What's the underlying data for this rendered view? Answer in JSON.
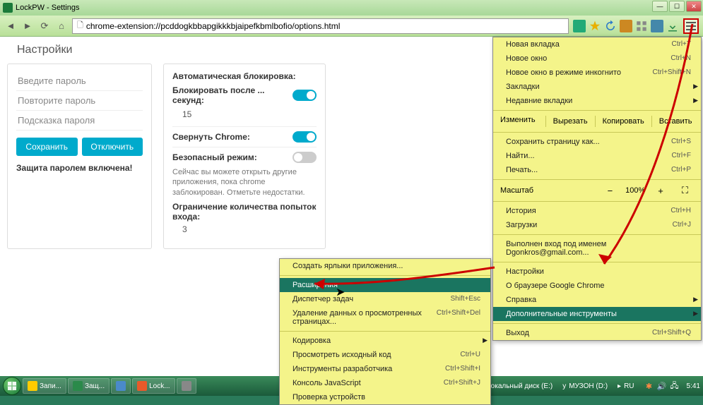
{
  "window": {
    "title": "LockPW - Settings"
  },
  "toolbar": {
    "url": "chrome-extension://pcddogkbbapgikkkbjaipefkbmlbofio/options.html"
  },
  "page": {
    "title": "Настройки",
    "left_panel": {
      "field_password": "Введите пароль",
      "field_repeat": "Повторите пароль",
      "field_hint": "Подсказка пароля",
      "btn_save": "Сохранить",
      "btn_disable": "Отключить",
      "status": "Защита паролем включена!"
    },
    "right_panel": {
      "autolock_title": "Автоматическая блокировка:",
      "autolock_label": "Блокировать после ... секунд:",
      "autolock_value": "15",
      "minimize_label": "Свернуть Chrome:",
      "safemode_label": "Безопасный режим:",
      "safemode_desc": "Сейчас вы можете открыть другие приложения, пока chrome заблокирован. Отметьте недостатки.",
      "attempts_label": "Ограничение количества попыток входа:",
      "attempts_value": "3"
    }
  },
  "chrome_menu": {
    "new_tab": "Новая вкладка",
    "new_tab_sc": "Ctrl+T",
    "new_window": "Новое окно",
    "new_window_sc": "Ctrl+N",
    "incognito": "Новое окно в режиме инкогнито",
    "incognito_sc": "Ctrl+Shift+N",
    "bookmarks": "Закладки",
    "recent_tabs": "Недавние вкладки",
    "edit_label": "Изменить",
    "cut": "Вырезать",
    "copy": "Копировать",
    "paste": "Вставить",
    "save_page": "Сохранить страницу как...",
    "save_page_sc": "Ctrl+S",
    "find": "Найти...",
    "find_sc": "Ctrl+F",
    "print": "Печать...",
    "print_sc": "Ctrl+P",
    "zoom_label": "Масштаб",
    "zoom_value": "100%",
    "history": "История",
    "history_sc": "Ctrl+H",
    "downloads": "Загрузки",
    "downloads_sc": "Ctrl+J",
    "signed_in": "Выполнен вход под именем Dgonkros@gmail.com...",
    "settings": "Настройки",
    "about": "О браузере Google Chrome",
    "help": "Справка",
    "more_tools": "Дополнительные инструменты",
    "exit": "Выход",
    "exit_sc": "Ctrl+Shift+Q"
  },
  "submenu": {
    "create_shortcuts": "Создать ярлыки приложения...",
    "extensions": "Расширения",
    "task_manager": "Диспетчер задач",
    "task_manager_sc": "Shift+Esc",
    "clear_data": "Удаление данных о просмотренных страницах...",
    "clear_data_sc": "Ctrl+Shift+Del",
    "encoding": "Кодировка",
    "view_source": "Просмотреть исходный код",
    "view_source_sc": "Ctrl+U",
    "dev_tools": "Инструменты разработчика",
    "dev_tools_sc": "Ctrl+Shift+I",
    "js_console": "Консоль JavaScript",
    "js_console_sc": "Ctrl+Shift+J",
    "inspect_devices": "Проверка устройств"
  },
  "taskbar": {
    "items": [
      "Запи...",
      "Защ...",
      "",
      "Lock...",
      ""
    ],
    "disk": "Локальный диск (E:)",
    "muzon": "МУЗОН (D:)",
    "lang": "RU",
    "time": "5:41"
  }
}
